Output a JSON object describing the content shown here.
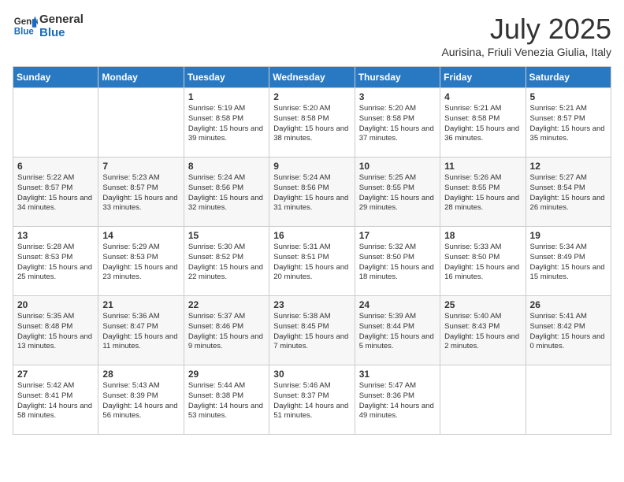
{
  "logo": {
    "line1": "General",
    "line2": "Blue"
  },
  "title": "July 2025",
  "subtitle": "Aurisina, Friuli Venezia Giulia, Italy",
  "days_of_week": [
    "Sunday",
    "Monday",
    "Tuesday",
    "Wednesday",
    "Thursday",
    "Friday",
    "Saturday"
  ],
  "weeks": [
    [
      {
        "day": "",
        "text": ""
      },
      {
        "day": "",
        "text": ""
      },
      {
        "day": "1",
        "text": "Sunrise: 5:19 AM\nSunset: 8:58 PM\nDaylight: 15 hours and 39 minutes."
      },
      {
        "day": "2",
        "text": "Sunrise: 5:20 AM\nSunset: 8:58 PM\nDaylight: 15 hours and 38 minutes."
      },
      {
        "day": "3",
        "text": "Sunrise: 5:20 AM\nSunset: 8:58 PM\nDaylight: 15 hours and 37 minutes."
      },
      {
        "day": "4",
        "text": "Sunrise: 5:21 AM\nSunset: 8:58 PM\nDaylight: 15 hours and 36 minutes."
      },
      {
        "day": "5",
        "text": "Sunrise: 5:21 AM\nSunset: 8:57 PM\nDaylight: 15 hours and 35 minutes."
      }
    ],
    [
      {
        "day": "6",
        "text": "Sunrise: 5:22 AM\nSunset: 8:57 PM\nDaylight: 15 hours and 34 minutes."
      },
      {
        "day": "7",
        "text": "Sunrise: 5:23 AM\nSunset: 8:57 PM\nDaylight: 15 hours and 33 minutes."
      },
      {
        "day": "8",
        "text": "Sunrise: 5:24 AM\nSunset: 8:56 PM\nDaylight: 15 hours and 32 minutes."
      },
      {
        "day": "9",
        "text": "Sunrise: 5:24 AM\nSunset: 8:56 PM\nDaylight: 15 hours and 31 minutes."
      },
      {
        "day": "10",
        "text": "Sunrise: 5:25 AM\nSunset: 8:55 PM\nDaylight: 15 hours and 29 minutes."
      },
      {
        "day": "11",
        "text": "Sunrise: 5:26 AM\nSunset: 8:55 PM\nDaylight: 15 hours and 28 minutes."
      },
      {
        "day": "12",
        "text": "Sunrise: 5:27 AM\nSunset: 8:54 PM\nDaylight: 15 hours and 26 minutes."
      }
    ],
    [
      {
        "day": "13",
        "text": "Sunrise: 5:28 AM\nSunset: 8:53 PM\nDaylight: 15 hours and 25 minutes."
      },
      {
        "day": "14",
        "text": "Sunrise: 5:29 AM\nSunset: 8:53 PM\nDaylight: 15 hours and 23 minutes."
      },
      {
        "day": "15",
        "text": "Sunrise: 5:30 AM\nSunset: 8:52 PM\nDaylight: 15 hours and 22 minutes."
      },
      {
        "day": "16",
        "text": "Sunrise: 5:31 AM\nSunset: 8:51 PM\nDaylight: 15 hours and 20 minutes."
      },
      {
        "day": "17",
        "text": "Sunrise: 5:32 AM\nSunset: 8:50 PM\nDaylight: 15 hours and 18 minutes."
      },
      {
        "day": "18",
        "text": "Sunrise: 5:33 AM\nSunset: 8:50 PM\nDaylight: 15 hours and 16 minutes."
      },
      {
        "day": "19",
        "text": "Sunrise: 5:34 AM\nSunset: 8:49 PM\nDaylight: 15 hours and 15 minutes."
      }
    ],
    [
      {
        "day": "20",
        "text": "Sunrise: 5:35 AM\nSunset: 8:48 PM\nDaylight: 15 hours and 13 minutes."
      },
      {
        "day": "21",
        "text": "Sunrise: 5:36 AM\nSunset: 8:47 PM\nDaylight: 15 hours and 11 minutes."
      },
      {
        "day": "22",
        "text": "Sunrise: 5:37 AM\nSunset: 8:46 PM\nDaylight: 15 hours and 9 minutes."
      },
      {
        "day": "23",
        "text": "Sunrise: 5:38 AM\nSunset: 8:45 PM\nDaylight: 15 hours and 7 minutes."
      },
      {
        "day": "24",
        "text": "Sunrise: 5:39 AM\nSunset: 8:44 PM\nDaylight: 15 hours and 5 minutes."
      },
      {
        "day": "25",
        "text": "Sunrise: 5:40 AM\nSunset: 8:43 PM\nDaylight: 15 hours and 2 minutes."
      },
      {
        "day": "26",
        "text": "Sunrise: 5:41 AM\nSunset: 8:42 PM\nDaylight: 15 hours and 0 minutes."
      }
    ],
    [
      {
        "day": "27",
        "text": "Sunrise: 5:42 AM\nSunset: 8:41 PM\nDaylight: 14 hours and 58 minutes."
      },
      {
        "day": "28",
        "text": "Sunrise: 5:43 AM\nSunset: 8:39 PM\nDaylight: 14 hours and 56 minutes."
      },
      {
        "day": "29",
        "text": "Sunrise: 5:44 AM\nSunset: 8:38 PM\nDaylight: 14 hours and 53 minutes."
      },
      {
        "day": "30",
        "text": "Sunrise: 5:46 AM\nSunset: 8:37 PM\nDaylight: 14 hours and 51 minutes."
      },
      {
        "day": "31",
        "text": "Sunrise: 5:47 AM\nSunset: 8:36 PM\nDaylight: 14 hours and 49 minutes."
      },
      {
        "day": "",
        "text": ""
      },
      {
        "day": "",
        "text": ""
      }
    ]
  ]
}
